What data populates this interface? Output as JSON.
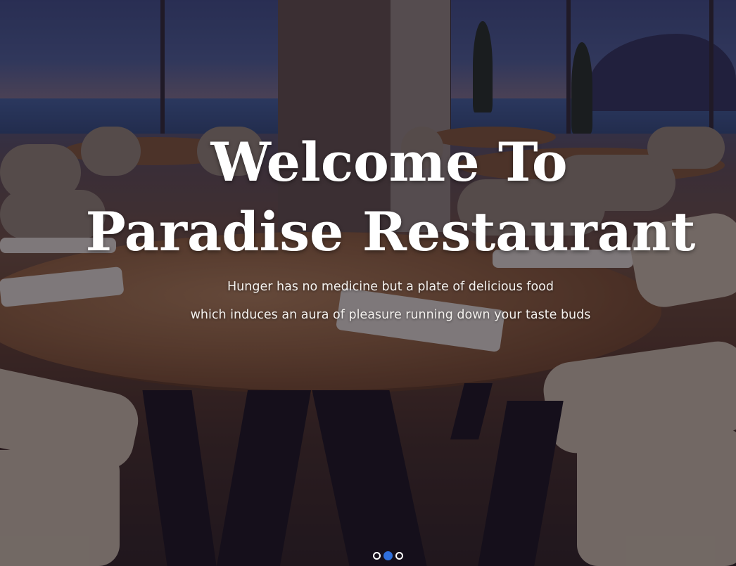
{
  "hero": {
    "title_line1": "Welcome To",
    "title_line2": "Paradise Restaurant",
    "subtitle_line1": "Hunger has no medicine but a plate of delicious food",
    "subtitle_line2": "which induces an aura of pleasure running down your taste buds"
  },
  "carousel": {
    "slide_count": 3,
    "active_slide": 2,
    "indicators": [
      "slide-1",
      "slide-2",
      "slide-3"
    ]
  },
  "colors": {
    "indicator_active": "#2f6fdc",
    "indicator_inactive": "#ffffff",
    "title_text": "#ffffff"
  }
}
